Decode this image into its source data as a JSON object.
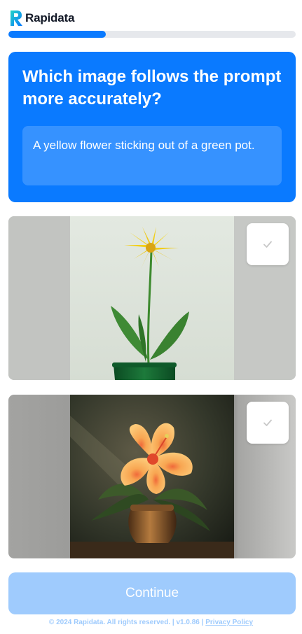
{
  "header": {
    "brand": "Rapidata",
    "logo_icon": "rapidata-logo-icon"
  },
  "progress": {
    "fraction": 0.34
  },
  "question": {
    "title": "Which image follows the prompt more accurately?",
    "prompt": "A yellow flower sticking out of a green pot."
  },
  "options": [
    {
      "image": "yellow-flower-green-pot-image",
      "check_icon": "check-icon"
    },
    {
      "image": "orange-hibiscus-clay-pot-image",
      "check_icon": "check-icon"
    }
  ],
  "actions": {
    "continue_label": "Continue"
  },
  "footer": {
    "copyright": "© 2024 Rapidata. All rights reserved.",
    "separator": "|",
    "version": "v1.0.86",
    "privacy_label": "Privacy Policy"
  },
  "colors": {
    "accent": "#0a7aff",
    "accent_disabled": "#9fcbfd",
    "progress_track": "#e6e8ec"
  }
}
